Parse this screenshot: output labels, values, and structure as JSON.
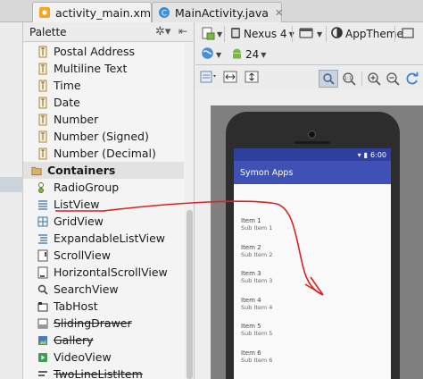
{
  "tabs": [
    {
      "label": "activity_main.xml",
      "icon": "xml-file-icon",
      "active": true
    },
    {
      "label": "MainActivity.java",
      "icon": "java-class-icon",
      "active": false
    }
  ],
  "palette": {
    "title": "Palette",
    "items": [
      {
        "label": "Postal Address",
        "icon": "text-field-icon"
      },
      {
        "label": "Multiline Text",
        "icon": "text-field-icon"
      },
      {
        "label": "Time",
        "icon": "text-field-icon"
      },
      {
        "label": "Date",
        "icon": "text-field-icon"
      },
      {
        "label": "Number",
        "icon": "text-field-icon"
      },
      {
        "label": "Number (Signed)",
        "icon": "text-field-icon"
      },
      {
        "label": "Number (Decimal)",
        "icon": "text-field-icon"
      },
      {
        "label": "Containers",
        "icon": "folder-icon",
        "group": true
      },
      {
        "label": "RadioGroup",
        "icon": "radio-group-icon"
      },
      {
        "label": "ListView",
        "icon": "list-view-icon"
      },
      {
        "label": "GridView",
        "icon": "grid-view-icon"
      },
      {
        "label": "ExpandableListView",
        "icon": "expandable-list-icon"
      },
      {
        "label": "ScrollView",
        "icon": "scroll-view-icon"
      },
      {
        "label": "HorizontalScrollView",
        "icon": "horizontal-scroll-icon"
      },
      {
        "label": "SearchView",
        "icon": "search-icon"
      },
      {
        "label": "TabHost",
        "icon": "tab-host-icon"
      },
      {
        "label": "SlidingDrawer",
        "icon": "sliding-drawer-icon",
        "deprecated": true
      },
      {
        "label": "Gallery",
        "icon": "gallery-icon",
        "deprecated": true
      },
      {
        "label": "VideoView",
        "icon": "video-view-icon"
      },
      {
        "label": "TwoLineListItem",
        "icon": "two-line-list-icon",
        "deprecated": true
      }
    ]
  },
  "toolbar": {
    "device": "Nexus 4",
    "theme": "AppTheme",
    "api_level": "24"
  },
  "preview": {
    "status_time": "6:00",
    "app_title": "Symon Apps",
    "list_items": [
      {
        "title": "Item 1",
        "sub": "Sub Item 1"
      },
      {
        "title": "Item 2",
        "sub": "Sub Item 2"
      },
      {
        "title": "Item 3",
        "sub": "Sub Item 3"
      },
      {
        "title": "Item 4",
        "sub": "Sub Item 4"
      },
      {
        "title": "Item 5",
        "sub": "Sub Item 5"
      },
      {
        "title": "Item 6",
        "sub": "Sub Item 6"
      }
    ]
  },
  "colors": {
    "app_bar": "#3f51b5",
    "status_bar": "#2f3f9f",
    "annotation": "#e02020"
  }
}
